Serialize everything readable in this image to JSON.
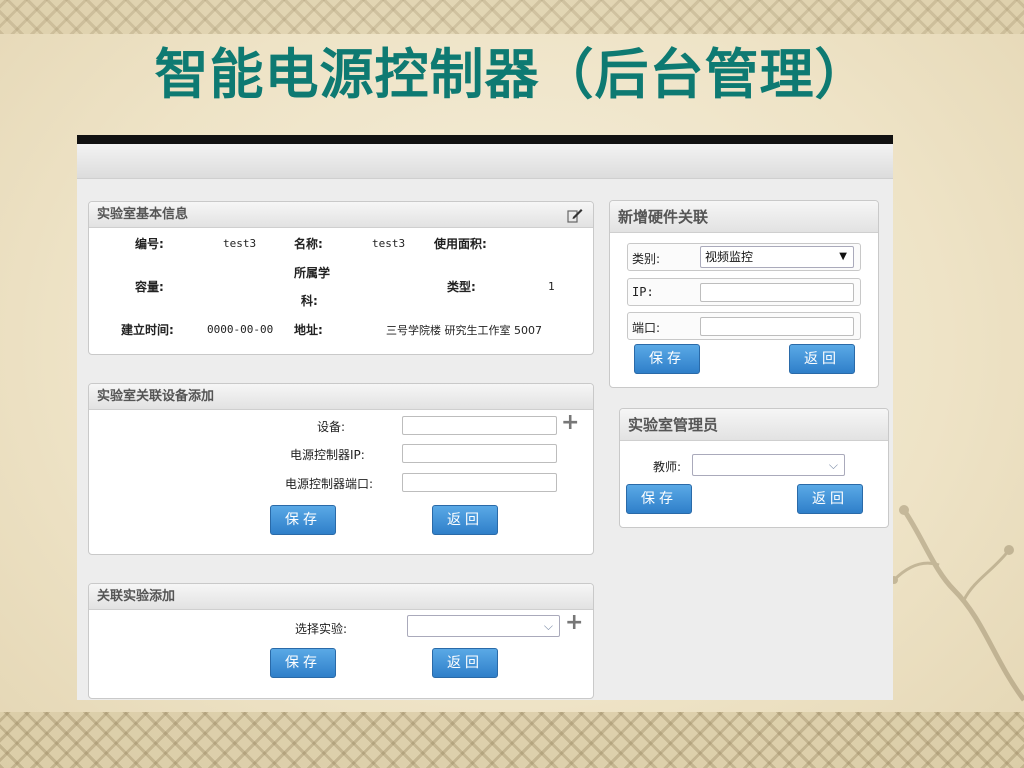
{
  "slide": {
    "title": "智能电源控制器（后台管理）"
  },
  "lab_info": {
    "title": "实验室基本信息",
    "number_label": "编号:",
    "number_value": "test3",
    "name_label": "名称:",
    "name_value": "test3",
    "area_label": "使用面积:",
    "area_value": "",
    "capacity_label": "容量:",
    "capacity_value": "",
    "subject_label_line1": "所属学",
    "subject_label_line2": "科:",
    "subject_value": "",
    "type_label": "类型:",
    "type_value": "1",
    "created_label": "建立时间:",
    "created_value": "0000-00-00",
    "address_label": "地址:",
    "address_value": "三号学院楼 研究生工作室 5007"
  },
  "device_add": {
    "title": "实验室关联设备添加",
    "device_label": "设备:",
    "device_value": "",
    "ip_label": "电源控制器IP:",
    "ip_value": "",
    "port_label": "电源控制器端口:",
    "port_value": "",
    "save_label": "保存",
    "back_label": "返回"
  },
  "experiment_add": {
    "title": "关联实验添加",
    "select_label": "选择实验:",
    "select_value": "",
    "save_label": "保存",
    "back_label": "返回"
  },
  "hardware": {
    "title": "新增硬件关联",
    "category_label": "类别:",
    "category_value": "视频监控",
    "ip_label": "IP:",
    "ip_value": "",
    "port_label": "端口:",
    "port_value": "",
    "save_label": "保存",
    "back_label": "返回"
  },
  "admin": {
    "title": "实验室管理员",
    "teacher_label": "教师:",
    "teacher_value": "",
    "save_label": "保存",
    "back_label": "返回"
  },
  "colors": {
    "title": "#0e7a72",
    "button": "#3a8bd4"
  }
}
